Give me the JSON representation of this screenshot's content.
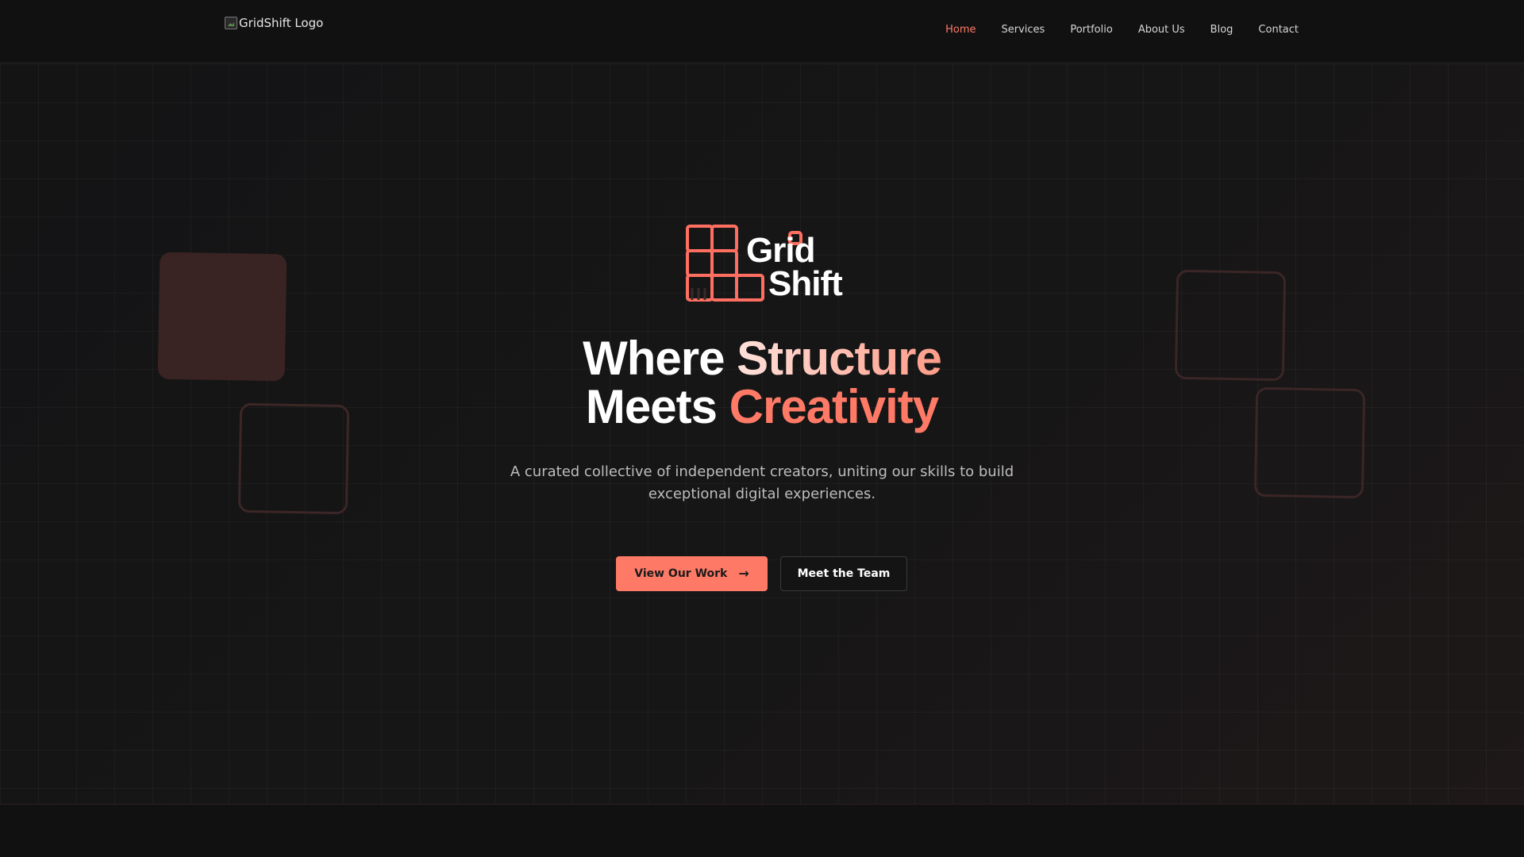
{
  "header": {
    "logo_alt": "GridShift Logo",
    "nav": [
      {
        "label": "Home",
        "active": true
      },
      {
        "label": "Services",
        "active": false
      },
      {
        "label": "Portfolio",
        "active": false
      },
      {
        "label": "About Us",
        "active": false
      },
      {
        "label": "Blog",
        "active": false
      },
      {
        "label": "Contact",
        "active": false
      }
    ]
  },
  "hero": {
    "brand_line1": "Grid",
    "brand_line2": "Shift",
    "headline_part1": "Where ",
    "headline_part2": "Structure",
    "headline_part3": "Meets ",
    "headline_part4": "Creativity",
    "subtitle": "A curated collective of independent creators, uniting our skills to build exceptional digital experiences.",
    "primary_button": "View Our Work",
    "secondary_button": "Meet the Team",
    "arrow_icon": "arrow-right-icon"
  },
  "colors": {
    "accent": "#ff7a66",
    "background": "#111112",
    "text": "#ffffff"
  }
}
